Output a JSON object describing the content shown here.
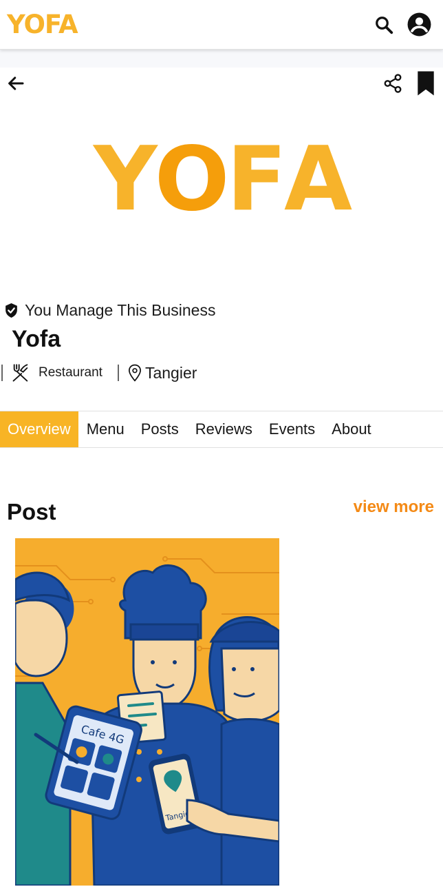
{
  "appbar": {
    "brand": "YOFA"
  },
  "hero": {
    "logo_text": "YOFA",
    "logo_letters": [
      "Y",
      "O",
      "F",
      "A"
    ]
  },
  "business": {
    "manage_label": "You Manage This Business",
    "name": "Yofa",
    "category": "Restaurant",
    "location": "Tangier"
  },
  "tabs": [
    {
      "label": "Overview",
      "active": true
    },
    {
      "label": "Menu",
      "active": false
    },
    {
      "label": "Posts",
      "active": false
    },
    {
      "label": "Reviews",
      "active": false
    },
    {
      "label": "Events",
      "active": false
    },
    {
      "label": "About",
      "active": false
    }
  ],
  "post_section": {
    "title": "Post",
    "view_more": "view more",
    "image": {
      "tablet_text": "Cafe 4G",
      "phone_text": "Tangier"
    }
  },
  "icons": {
    "search": "search-icon",
    "account": "account-circle-icon",
    "back": "arrow-left-icon",
    "share": "share-icon",
    "bookmark": "bookmark-icon",
    "verified": "verified-shield-icon",
    "category": "fork-knife-icon",
    "location": "location-pin-icon"
  },
  "colors": {
    "brand_yellow": "#f7b32b",
    "brand_orange": "#f48a16",
    "tab_active_bg": "#f8b425",
    "illustration_blue": "#1d4fa3"
  }
}
